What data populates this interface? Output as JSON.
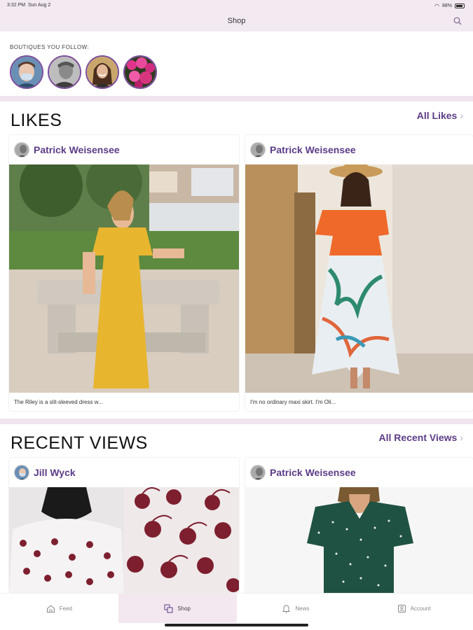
{
  "status_bar": {
    "time": "3:32 PM",
    "date": "Sun Aug 2",
    "battery": "88%"
  },
  "nav": {
    "title": "Shop",
    "search_icon": "search-icon"
  },
  "boutiques": {
    "label": "BOUTIQUES YOU FOLLOW:",
    "items": [
      {
        "icon": "boutique-avatar-masked-woman"
      },
      {
        "icon": "boutique-avatar-man"
      },
      {
        "icon": "boutique-avatar-woman-smiling"
      },
      {
        "icon": "boutique-avatar-pink-flowers"
      }
    ]
  },
  "likes": {
    "title": "LIKES",
    "link": "All Likes",
    "cards": [
      {
        "author": "Patrick Weisensee",
        "caption": "The Riley is a slit-sleeved dress w...",
        "photo": "yellow-dress-photo"
      },
      {
        "author": "Patrick Weisensee",
        "caption": "I'm no ordinary maxi skirt. I'm Oli...",
        "photo": "tropical-maxi-skirt-photo"
      }
    ]
  },
  "recent_views": {
    "title": "RECENT VIEWS",
    "link": "All Recent Views",
    "cards": [
      {
        "author": "Jill Wyck",
        "photo": "cherry-print-top-photo"
      },
      {
        "author": "Patrick Weisensee",
        "photo": "green-polka-dot-tee-photo"
      }
    ]
  },
  "tabs": [
    {
      "label": "Feed",
      "icon": "home-icon",
      "active": false
    },
    {
      "label": "Shop",
      "icon": "shop-icon",
      "active": true
    },
    {
      "label": "News",
      "icon": "bell-icon",
      "active": false
    },
    {
      "label": "Account",
      "icon": "account-icon",
      "active": false
    }
  ],
  "colors": {
    "accent": "#5b3c86",
    "header_bg": "#f3e9f1",
    "band": "#f0e4ee"
  }
}
